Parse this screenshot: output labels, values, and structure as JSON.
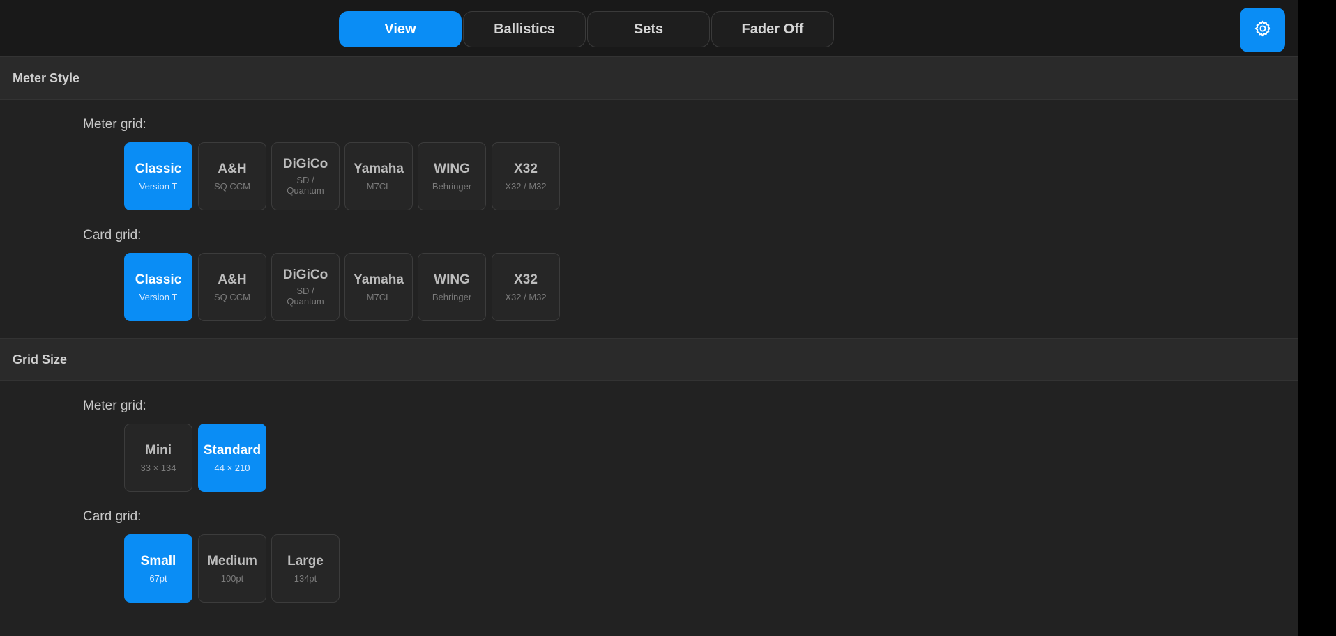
{
  "tabs": [
    {
      "label": "View",
      "active": true
    },
    {
      "label": "Ballistics",
      "active": false
    },
    {
      "label": "Sets",
      "active": false
    },
    {
      "label": "Fader Off",
      "active": false
    }
  ],
  "settings_icon": "gear-icon",
  "meter_style": {
    "title": "Meter Style",
    "meter_grid": {
      "label": "Meter grid:",
      "options": [
        {
          "title": "Classic",
          "sub": "Version T",
          "selected": true
        },
        {
          "title": "A&H",
          "sub": "SQ CCM",
          "selected": false
        },
        {
          "title": "DiGiCo",
          "sub": "SD /\nQuantum",
          "selected": false
        },
        {
          "title": "Yamaha",
          "sub": "M7CL",
          "selected": false
        },
        {
          "title": "WING",
          "sub": "Behringer",
          "selected": false
        },
        {
          "title": "X32",
          "sub": "X32 / M32",
          "selected": false
        }
      ]
    },
    "card_grid": {
      "label": "Card grid:",
      "options": [
        {
          "title": "Classic",
          "sub": "Version T",
          "selected": true
        },
        {
          "title": "A&H",
          "sub": "SQ CCM",
          "selected": false
        },
        {
          "title": "DiGiCo",
          "sub": "SD /\nQuantum",
          "selected": false
        },
        {
          "title": "Yamaha",
          "sub": "M7CL",
          "selected": false
        },
        {
          "title": "WING",
          "sub": "Behringer",
          "selected": false
        },
        {
          "title": "X32",
          "sub": "X32 / M32",
          "selected": false
        }
      ]
    }
  },
  "grid_size": {
    "title": "Grid Size",
    "meter_grid": {
      "label": "Meter grid:",
      "options": [
        {
          "title": "Mini",
          "sub": "33 × 134",
          "selected": false
        },
        {
          "title": "Standard",
          "sub": "44 × 210",
          "selected": true
        }
      ]
    },
    "card_grid": {
      "label": "Card grid:",
      "options": [
        {
          "title": "Small",
          "sub": "67pt",
          "selected": true
        },
        {
          "title": "Medium",
          "sub": "100pt",
          "selected": false
        },
        {
          "title": "Large",
          "sub": "134pt",
          "selected": false
        }
      ]
    }
  },
  "colors": {
    "accent": "#0a8df5",
    "background": "#222222",
    "header": "#2a2a2a"
  }
}
